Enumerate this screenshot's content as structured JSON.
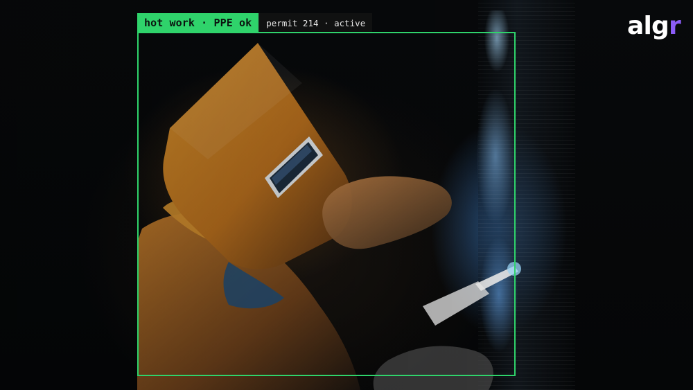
{
  "overlay": {
    "tag_primary": "hot work · PPE ok",
    "tag_secondary": "permit 214 · active",
    "accent_color": "#2fd36b"
  },
  "brand": {
    "logo_text_main": "alg",
    "logo_text_accent": "r",
    "accent_color": "#8b5cf6"
  }
}
